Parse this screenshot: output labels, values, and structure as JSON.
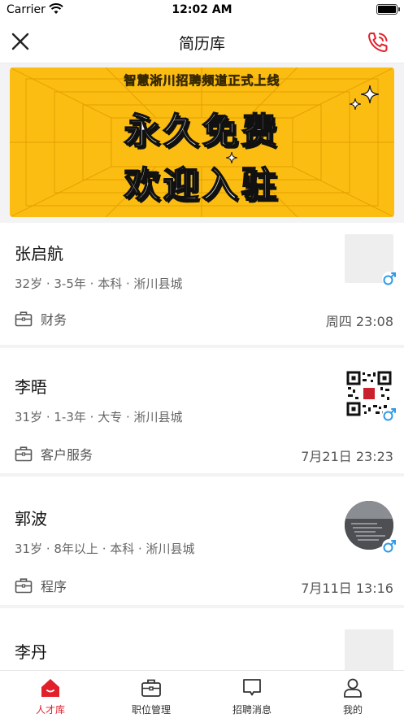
{
  "status_bar": {
    "carrier": "Carrier",
    "time": "12:02 AM"
  },
  "nav": {
    "title": "简历库",
    "close_icon": "close-icon",
    "phone_icon": "phone-icon"
  },
  "banner": {
    "subtitle": "智慧淅川招聘频道正式上线",
    "line1": "永久免费",
    "line2": "欢迎入驻",
    "color": "#fbbd12"
  },
  "candidates": [
    {
      "name": "张启航",
      "info": "32岁 · 3-5年 · 本科 · 淅川县城",
      "job": "财务",
      "time": "周四 23:08",
      "gender": "male"
    },
    {
      "name": "李晤",
      "info": "31岁 · 1-3年 · 大专 · 淅川县城",
      "job": "客户服务",
      "time": "7月21日 23:23",
      "gender": "male"
    },
    {
      "name": "郭波",
      "info": "31岁 · 8年以上 · 本科 · 淅川县城",
      "job": "程序",
      "time": "7月11日 13:16",
      "gender": "male"
    },
    {
      "name": "李丹"
    }
  ],
  "tabs": [
    {
      "label": "人才库",
      "icon": "home-icon",
      "active": true
    },
    {
      "label": "职位管理",
      "icon": "briefcase-icon",
      "active": false
    },
    {
      "label": "招聘消息",
      "icon": "message-icon",
      "active": false
    },
    {
      "label": "我的",
      "icon": "user-icon",
      "active": false
    }
  ],
  "colors": {
    "accent": "#e2202c",
    "male": "#2f9be8"
  }
}
